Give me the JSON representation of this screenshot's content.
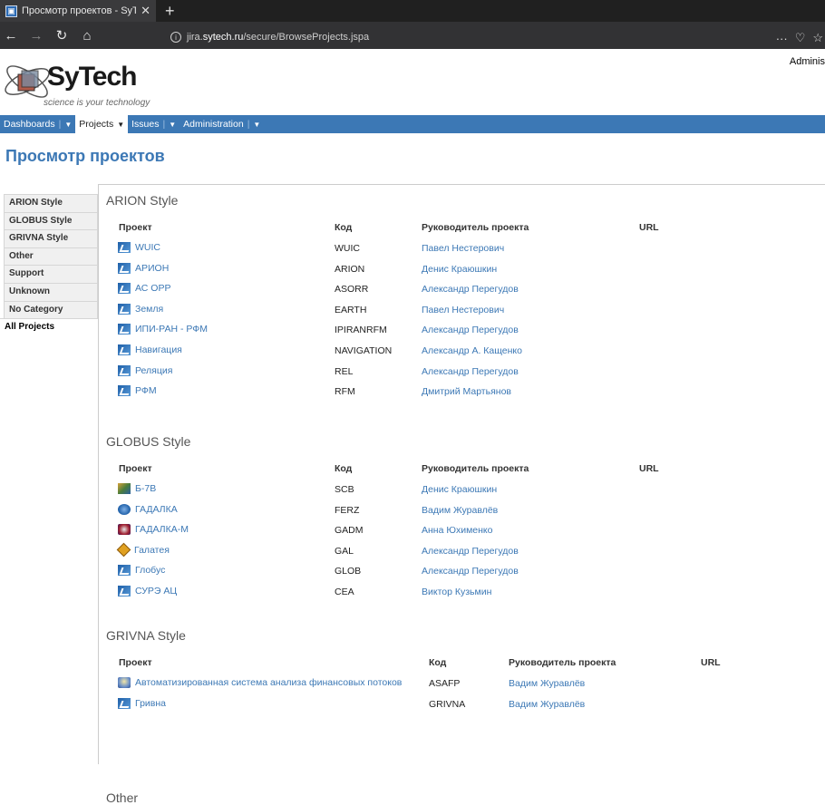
{
  "browser": {
    "tab_title": "Просмотр проектов - SyTech",
    "url_prefix": "jira.",
    "url_host": "sytech.ru",
    "url_path": "/secure/BrowseProjects.jspa"
  },
  "header": {
    "logo_brand": "SyTech",
    "logo_tagline": "science is your technology",
    "user_link": "Adminis"
  },
  "menu": [
    {
      "label": "Dashboards",
      "active": false
    },
    {
      "label": "Projects",
      "active": true
    },
    {
      "label": "Issues",
      "active": false
    },
    {
      "label": "Administration",
      "active": false
    }
  ],
  "page_title": "Просмотр проектов",
  "sidebar": [
    {
      "label": "ARION Style"
    },
    {
      "label": "GLOBUS Style"
    },
    {
      "label": "GRIVNA Style"
    },
    {
      "label": "Other"
    },
    {
      "label": "Support"
    },
    {
      "label": "Unknown"
    },
    {
      "label": "No Category"
    },
    {
      "label": "All Projects",
      "active": true
    }
  ],
  "columns": {
    "project": "Проект",
    "key": "Код",
    "lead": "Руководитель проекта",
    "url": "URL"
  },
  "sections": [
    {
      "title": "ARION Style",
      "rows": [
        {
          "icon": "blue",
          "name": "WUIC",
          "key": "WUIC",
          "lead": "Павел Нестерович"
        },
        {
          "icon": "blue",
          "name": "АРИОН",
          "key": "ARION",
          "lead": "Денис Краюшкин"
        },
        {
          "icon": "blue",
          "name": "АС ОРР",
          "key": "ASORR",
          "lead": "Александр Перегудов"
        },
        {
          "icon": "blue",
          "name": "Земля",
          "key": "EARTH",
          "lead": "Павел Нестерович"
        },
        {
          "icon": "blue",
          "name": "ИПИ-РАН - РФМ",
          "key": "IPIRANRFM",
          "lead": "Александр Перегудов"
        },
        {
          "icon": "blue",
          "name": "Навигация",
          "key": "NAVIGATION",
          "lead": "Александр А. Кащенко"
        },
        {
          "icon": "blue",
          "name": "Реляция",
          "key": "REL",
          "lead": "Александр Перегудов"
        },
        {
          "icon": "blue",
          "name": "РФМ",
          "key": "RFM",
          "lead": "Дмитрий Мартьянов"
        }
      ]
    },
    {
      "title": "GLOBUS Style",
      "rows": [
        {
          "icon": "b7",
          "name": "Б-7В",
          "key": "SCB",
          "lead": "Денис Краюшкин"
        },
        {
          "icon": "globe",
          "name": "ГАДАЛКА",
          "key": "FERZ",
          "lead": "Вадим Журавлёв"
        },
        {
          "icon": "gadm",
          "name": "ГАДАЛКА-М",
          "key": "GADM",
          "lead": "Анна Юхименко"
        },
        {
          "icon": "diamond",
          "name": "Галатея",
          "key": "GAL",
          "lead": "Александр Перегудов"
        },
        {
          "icon": "blue",
          "name": "Глобус",
          "key": "GLOB",
          "lead": "Александр Перегудов"
        },
        {
          "icon": "blue",
          "name": "СУРЭ АЦ",
          "key": "CEA",
          "lead": "Виктор Кузьмин"
        }
      ]
    },
    {
      "title": "GRIVNA Style",
      "rows": [
        {
          "icon": "finance",
          "name": "Автоматизированная система анализа финансовых потоков",
          "key": "ASAFP",
          "lead": "Вадим Журавлёв"
        },
        {
          "icon": "blue",
          "name": "Гривна",
          "key": "GRIVNA",
          "lead": "Вадим Журавлёв"
        }
      ]
    },
    {
      "title": "Other",
      "rows": []
    }
  ]
}
